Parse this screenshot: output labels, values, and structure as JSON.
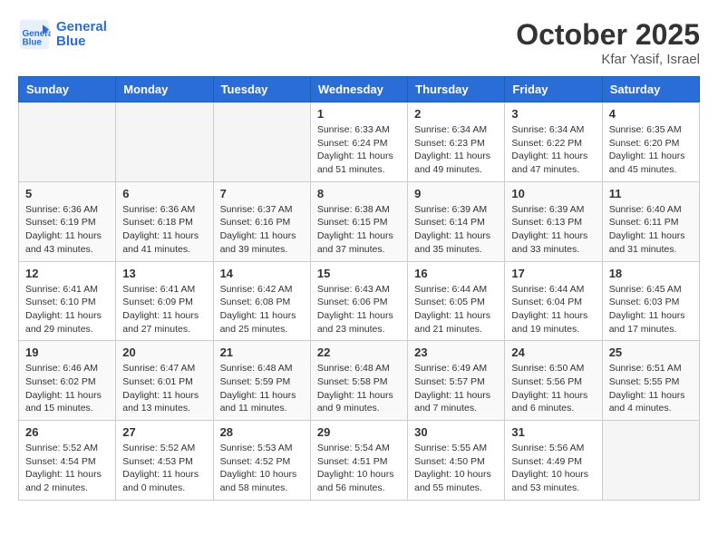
{
  "header": {
    "logo_line1": "General",
    "logo_line2": "Blue",
    "month_title": "October 2025",
    "subtitle": "Kfar Yasif, Israel"
  },
  "days_of_week": [
    "Sunday",
    "Monday",
    "Tuesday",
    "Wednesday",
    "Thursday",
    "Friday",
    "Saturday"
  ],
  "weeks": [
    [
      {
        "day": "",
        "empty": true
      },
      {
        "day": "",
        "empty": true
      },
      {
        "day": "",
        "empty": true
      },
      {
        "day": "1",
        "sunrise": "6:33 AM",
        "sunset": "6:24 PM",
        "daylight": "11 hours and 51 minutes."
      },
      {
        "day": "2",
        "sunrise": "6:34 AM",
        "sunset": "6:23 PM",
        "daylight": "11 hours and 49 minutes."
      },
      {
        "day": "3",
        "sunrise": "6:34 AM",
        "sunset": "6:22 PM",
        "daylight": "11 hours and 47 minutes."
      },
      {
        "day": "4",
        "sunrise": "6:35 AM",
        "sunset": "6:20 PM",
        "daylight": "11 hours and 45 minutes."
      }
    ],
    [
      {
        "day": "5",
        "sunrise": "6:36 AM",
        "sunset": "6:19 PM",
        "daylight": "11 hours and 43 minutes."
      },
      {
        "day": "6",
        "sunrise": "6:36 AM",
        "sunset": "6:18 PM",
        "daylight": "11 hours and 41 minutes."
      },
      {
        "day": "7",
        "sunrise": "6:37 AM",
        "sunset": "6:16 PM",
        "daylight": "11 hours and 39 minutes."
      },
      {
        "day": "8",
        "sunrise": "6:38 AM",
        "sunset": "6:15 PM",
        "daylight": "11 hours and 37 minutes."
      },
      {
        "day": "9",
        "sunrise": "6:39 AM",
        "sunset": "6:14 PM",
        "daylight": "11 hours and 35 minutes."
      },
      {
        "day": "10",
        "sunrise": "6:39 AM",
        "sunset": "6:13 PM",
        "daylight": "11 hours and 33 minutes."
      },
      {
        "day": "11",
        "sunrise": "6:40 AM",
        "sunset": "6:11 PM",
        "daylight": "11 hours and 31 minutes."
      }
    ],
    [
      {
        "day": "12",
        "sunrise": "6:41 AM",
        "sunset": "6:10 PM",
        "daylight": "11 hours and 29 minutes."
      },
      {
        "day": "13",
        "sunrise": "6:41 AM",
        "sunset": "6:09 PM",
        "daylight": "11 hours and 27 minutes."
      },
      {
        "day": "14",
        "sunrise": "6:42 AM",
        "sunset": "6:08 PM",
        "daylight": "11 hours and 25 minutes."
      },
      {
        "day": "15",
        "sunrise": "6:43 AM",
        "sunset": "6:06 PM",
        "daylight": "11 hours and 23 minutes."
      },
      {
        "day": "16",
        "sunrise": "6:44 AM",
        "sunset": "6:05 PM",
        "daylight": "11 hours and 21 minutes."
      },
      {
        "day": "17",
        "sunrise": "6:44 AM",
        "sunset": "6:04 PM",
        "daylight": "11 hours and 19 minutes."
      },
      {
        "day": "18",
        "sunrise": "6:45 AM",
        "sunset": "6:03 PM",
        "daylight": "11 hours and 17 minutes."
      }
    ],
    [
      {
        "day": "19",
        "sunrise": "6:46 AM",
        "sunset": "6:02 PM",
        "daylight": "11 hours and 15 minutes."
      },
      {
        "day": "20",
        "sunrise": "6:47 AM",
        "sunset": "6:01 PM",
        "daylight": "11 hours and 13 minutes."
      },
      {
        "day": "21",
        "sunrise": "6:48 AM",
        "sunset": "5:59 PM",
        "daylight": "11 hours and 11 minutes."
      },
      {
        "day": "22",
        "sunrise": "6:48 AM",
        "sunset": "5:58 PM",
        "daylight": "11 hours and 9 minutes."
      },
      {
        "day": "23",
        "sunrise": "6:49 AM",
        "sunset": "5:57 PM",
        "daylight": "11 hours and 7 minutes."
      },
      {
        "day": "24",
        "sunrise": "6:50 AM",
        "sunset": "5:56 PM",
        "daylight": "11 hours and 6 minutes."
      },
      {
        "day": "25",
        "sunrise": "6:51 AM",
        "sunset": "5:55 PM",
        "daylight": "11 hours and 4 minutes."
      }
    ],
    [
      {
        "day": "26",
        "sunrise": "5:52 AM",
        "sunset": "4:54 PM",
        "daylight": "11 hours and 2 minutes."
      },
      {
        "day": "27",
        "sunrise": "5:52 AM",
        "sunset": "4:53 PM",
        "daylight": "11 hours and 0 minutes."
      },
      {
        "day": "28",
        "sunrise": "5:53 AM",
        "sunset": "4:52 PM",
        "daylight": "10 hours and 58 minutes."
      },
      {
        "day": "29",
        "sunrise": "5:54 AM",
        "sunset": "4:51 PM",
        "daylight": "10 hours and 56 minutes."
      },
      {
        "day": "30",
        "sunrise": "5:55 AM",
        "sunset": "4:50 PM",
        "daylight": "10 hours and 55 minutes."
      },
      {
        "day": "31",
        "sunrise": "5:56 AM",
        "sunset": "4:49 PM",
        "daylight": "10 hours and 53 minutes."
      },
      {
        "day": "",
        "empty": true
      }
    ]
  ]
}
